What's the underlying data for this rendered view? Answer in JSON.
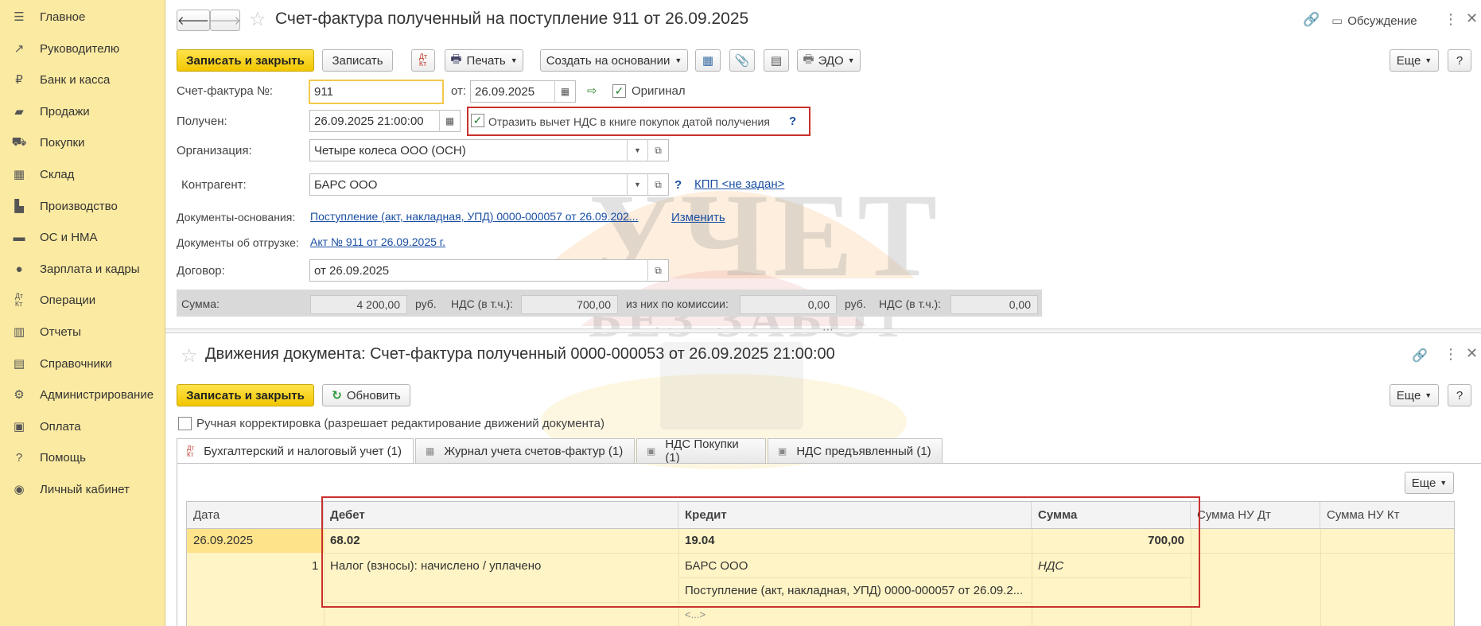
{
  "sidebar": {
    "items": [
      {
        "label": "Главное",
        "icon": "menu-icon"
      },
      {
        "label": "Руководителю",
        "icon": "trend-icon"
      },
      {
        "label": "Банк и касса",
        "icon": "ruble-icon"
      },
      {
        "label": "Продажи",
        "icon": "bag-icon"
      },
      {
        "label": "Покупки",
        "icon": "cart-icon"
      },
      {
        "label": "Склад",
        "icon": "warehouse-icon"
      },
      {
        "label": "Производство",
        "icon": "factory-icon"
      },
      {
        "label": "ОС и НМА",
        "icon": "truck-icon"
      },
      {
        "label": "Зарплата и кадры",
        "icon": "person-icon"
      },
      {
        "label": "Операции",
        "icon": "dt-kt-icon"
      },
      {
        "label": "Отчеты",
        "icon": "chart-icon"
      },
      {
        "label": "Справочники",
        "icon": "book-icon"
      },
      {
        "label": "Администрирование",
        "icon": "gear-icon"
      },
      {
        "label": "Оплата",
        "icon": "wallet-icon"
      },
      {
        "label": "Помощь",
        "icon": "question-icon"
      },
      {
        "label": "Личный кабинет",
        "icon": "account-icon"
      }
    ]
  },
  "doc": {
    "title": "Счет-фактура полученный на поступление 911 от 26.09.2025",
    "discussion": "Обсуждение",
    "toolbar": {
      "save_close": "Записать и закрыть",
      "save": "Записать",
      "print": "Печать",
      "create_based": "Создать на основании",
      "edo": "ЭДО",
      "more": "Еще",
      "help": "?"
    },
    "invoice_no_label": "Счет-фактура №:",
    "invoice_no": "911",
    "from_label": "от:",
    "from_date": "26.09.2025",
    "original_label": "Оригинал",
    "received_label": "Получен:",
    "received_datetime": "26.09.2025 21:00:00",
    "vat_deduct_label": "Отразить вычет НДС в книге покупок датой получения",
    "hint": "?",
    "org_label": "Организация:",
    "org": "Четыре колеса ООО (ОСН)",
    "counterparty_label": "Контрагент:",
    "counterparty": "БАРС ООО",
    "kpp_link": "КПП <не задан>",
    "base_docs_label": "Документы-основания:",
    "base_docs": "Поступление (акт, накладная, УПД) 0000-000057 от 26.09.202...",
    "change_link": "Изменить",
    "shipment_docs_label": "Документы об отгрузке:",
    "shipment_docs": "Акт № 911 от 26.09.2025 г.",
    "contract_label": "Договор:",
    "contract": "от 26.09.2025",
    "totals": {
      "sum_label": "Сумма:",
      "sum": "4 200,00",
      "rub": "руб.",
      "vat_label": "НДС (в т.ч.):",
      "vat": "700,00",
      "commission_label": "из них по комиссии:",
      "commission": "0,00",
      "rub2": "руб.",
      "vat2_label": "НДС (в т.ч.):",
      "vat2": "0,00"
    }
  },
  "movements": {
    "title": "Движения документа: Счет-фактура полученный 0000-000053 от 26.09.2025 21:00:00",
    "save_close": "Записать и закрыть",
    "refresh": "Обновить",
    "more": "Еще",
    "help": "?",
    "manual_edit": "Ручная корректировка (разрешает редактирование движений документа)",
    "tabs": [
      "Бухгалтерский и налоговый учет (1)",
      "Журнал учета счетов-фактур (1)",
      "НДС Покупки (1)",
      "НДС предъявленный (1)"
    ],
    "grid_more": "Еще",
    "columns": [
      "Дата",
      "Дебет",
      "Кредит",
      "Сумма",
      "Сумма НУ Дт",
      "Сумма НУ Кт"
    ],
    "row": {
      "date": "26.09.2025",
      "num": "1",
      "debit_account": "68.02",
      "debit_sub1": "Налог (взносы): начислено / уплачено",
      "credit_account": "19.04",
      "credit_sub1": "БАРС ООО",
      "credit_sub2": "Поступление (акт, накладная, УПД) 0000-000057 от 26.09.2...",
      "credit_sub3": "<...>",
      "amount": "700,00",
      "amount_note": "НДС"
    }
  },
  "watermark": {
    "line1": "УЧЕТ",
    "line2": "БЕЗ ЗАБОТ"
  },
  "colors": {
    "sidebar": "#fbeaa1",
    "accent_button": "#f2c600",
    "highlight": "#c9302c",
    "link": "#1a4fa3"
  }
}
